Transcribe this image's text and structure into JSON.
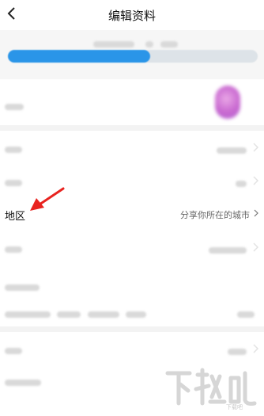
{
  "header": {
    "title": "编辑资料",
    "back_icon": "chevron-left-icon"
  },
  "progress": {
    "fraction": 0.57,
    "color": "#2a95e8"
  },
  "rows": {
    "region": {
      "label": "地区",
      "value": "分享你所在的城市"
    }
  },
  "annotation": {
    "arrow_color": "#e8231f"
  },
  "watermark": {
    "text": "下载吧"
  }
}
